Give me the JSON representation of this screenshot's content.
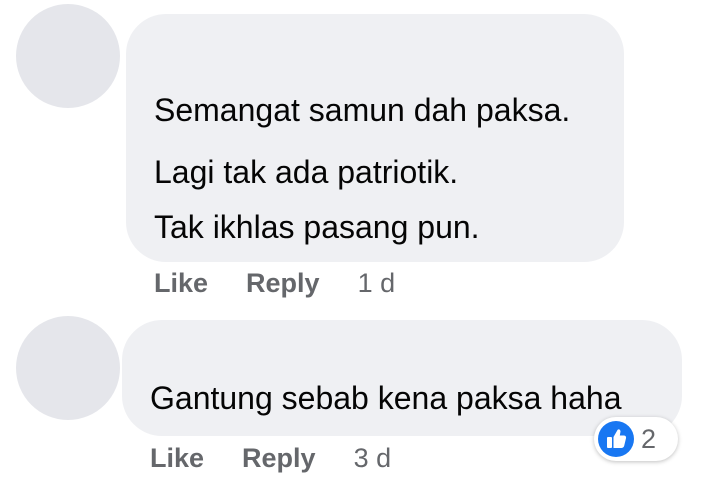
{
  "comments": [
    {
      "lines": [
        "Semangat samun dah paksa.",
        "Lagi tak ada patriotik.",
        "Tak ikhlas pasang pun."
      ],
      "actions": {
        "like_label": "Like",
        "reply_label": "Reply",
        "time": "1 d"
      }
    },
    {
      "lines": [
        "Gantung sebab kena paksa haha"
      ],
      "actions": {
        "like_label": "Like",
        "reply_label": "Reply",
        "time": "3 d"
      },
      "reaction": {
        "icon": "like-reaction-icon",
        "count": "2",
        "color": "#1877f2"
      }
    }
  ]
}
